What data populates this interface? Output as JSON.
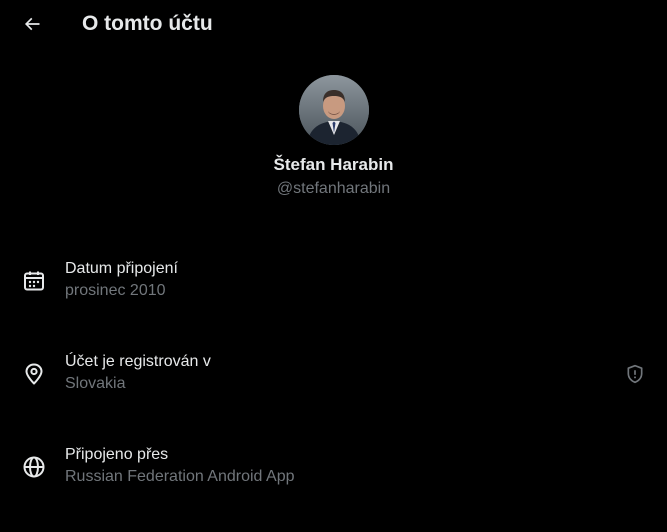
{
  "header": {
    "title": "O tomto účtu",
    "back_icon": "arrow-left-icon"
  },
  "profile": {
    "name": "Štefan Harabin",
    "handle": "@stefanharabin"
  },
  "rows": [
    {
      "icon": "calendar-icon",
      "label": "Datum připojení",
      "value": "prosinec 2010"
    },
    {
      "icon": "location-pin-icon",
      "label": "Účet je registrován v",
      "value": "Slovakia",
      "trailing_icon": "shield-icon"
    },
    {
      "icon": "globe-icon",
      "label": "Připojeno přes",
      "value": "Russian Federation Android App"
    }
  ],
  "colors": {
    "background": "#000000",
    "primary_text": "#e7e9ea",
    "secondary_text": "#71767b"
  }
}
